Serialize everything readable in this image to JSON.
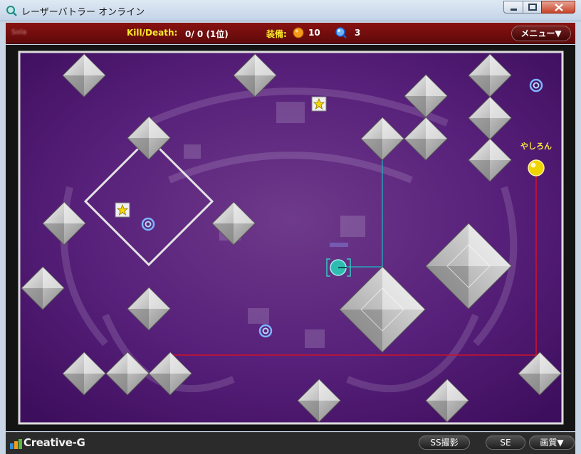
{
  "window": {
    "title": "レーザーバトラー オンライン"
  },
  "hud": {
    "player_name": "Sola",
    "kd_label": "Kill/Death:",
    "kd_value": "0/ 0 (1位)",
    "equip_label": "装備:",
    "orb_count": "10",
    "lens_count": "3",
    "menu_label": "メニュー▼"
  },
  "board": {
    "opponent_name": "やしろん",
    "colors": {
      "field": "#5b1f7e",
      "mirror": "#c8c8c8",
      "laser_red": "#d0102a",
      "laser_cyan": "#27a6b8",
      "opponent": "#f0d400",
      "player": "#2fbcb0",
      "frame": "#d8d8d8"
    }
  },
  "footer": {
    "logo_text": "Creative-G",
    "screenshot_label": "SS撮影",
    "se_label": "SE",
    "quality_label": "画質▼"
  },
  "icons": {
    "app": "magnifier-icon",
    "orb": "orange-orb-icon",
    "lens": "lens-icon",
    "star": "star-item-icon",
    "ring": "ring-item-icon"
  }
}
